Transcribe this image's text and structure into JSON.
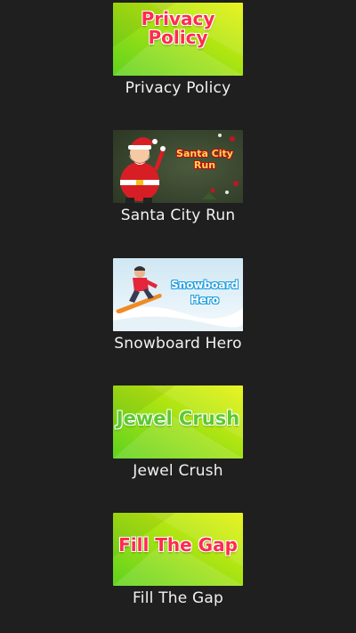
{
  "items": [
    {
      "label": "Privacy Policy",
      "thumb_title_line1": "Privacy",
      "thumb_title_line2": "Policy",
      "icon": "privacy-policy-thumbnail"
    },
    {
      "label": "Santa City Run",
      "thumb_title": "Santa City Run",
      "icon": "santa-thumbnail"
    },
    {
      "label": "Snowboard Hero",
      "thumb_title_line1": "Snowboard",
      "thumb_title_line2": "Hero",
      "icon": "snowboarder-thumbnail"
    },
    {
      "label": "Jewel Crush",
      "thumb_title": "Jewel Crush",
      "icon": "jewel-crush-thumbnail"
    },
    {
      "label": "Fill The Gap",
      "thumb_title": "Fill The Gap",
      "icon": "fill-the-gap-thumbnail"
    }
  ],
  "colors": {
    "background": "#1f1f1f",
    "label_text": "#f2f2f2",
    "green_gradient_start": "#5fd21e",
    "green_gradient_end": "#e7f20a",
    "red_title": "#ff2b4e"
  }
}
